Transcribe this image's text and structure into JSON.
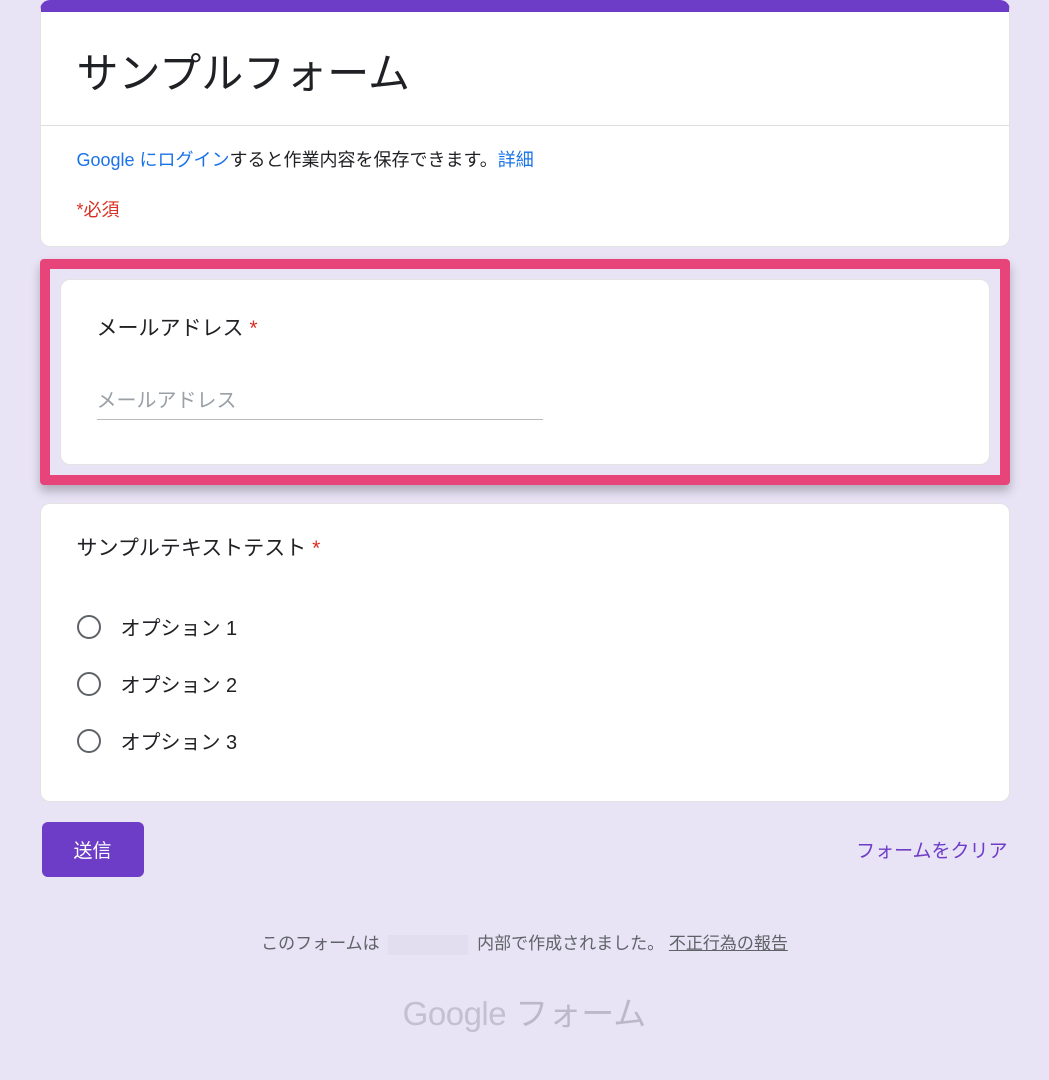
{
  "header": {
    "title": "サンプルフォーム"
  },
  "info": {
    "login_link": "Google にログイン",
    "login_suffix": "すると作業内容を保存できます。",
    "detail_link": "詳細",
    "required_note": "*必須"
  },
  "email_question": {
    "label": "メールアドレス",
    "asterisk": "*",
    "placeholder": "メールアドレス",
    "value": ""
  },
  "radio_question": {
    "label": "サンプルテキストテスト",
    "asterisk": "*",
    "options": [
      {
        "label": "オプション 1"
      },
      {
        "label": "オプション 2"
      },
      {
        "label": "オプション 3"
      }
    ]
  },
  "actions": {
    "submit": "送信",
    "clear": "フォームをクリア"
  },
  "footer": {
    "prefix": "このフォームは",
    "suffix": "内部で作成されました。",
    "report": "不正行為の報告"
  },
  "brand": {
    "google": "Google",
    "product": " フォーム"
  }
}
